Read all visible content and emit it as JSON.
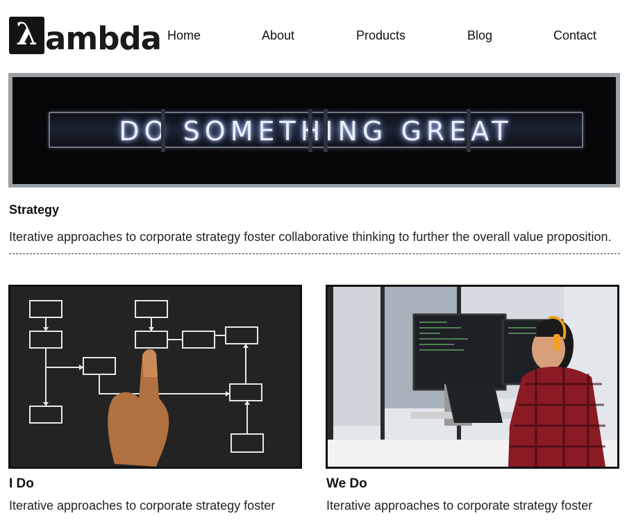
{
  "header": {
    "logo_glyph": "λ",
    "logo_text": "ambda",
    "nav": [
      "Home",
      "About",
      "Products",
      "Blog",
      "Contact"
    ]
  },
  "hero": {
    "sign_text": "DO SOMETHING GREAT"
  },
  "strategy": {
    "title": "Strategy",
    "description": "Iterative approaches to corporate strategy foster collaborative thinking to further the overall value proposition."
  },
  "cards": [
    {
      "title": "I Do",
      "description": "Iterative approaches to corporate strategy foster"
    },
    {
      "title": "We Do",
      "description": "Iterative approaches to corporate strategy foster"
    }
  ],
  "colors": {
    "text": "#111111",
    "hero_frame": "#9aa0a4",
    "hero_bg": "#050608",
    "diagram_bg": "#222222"
  }
}
